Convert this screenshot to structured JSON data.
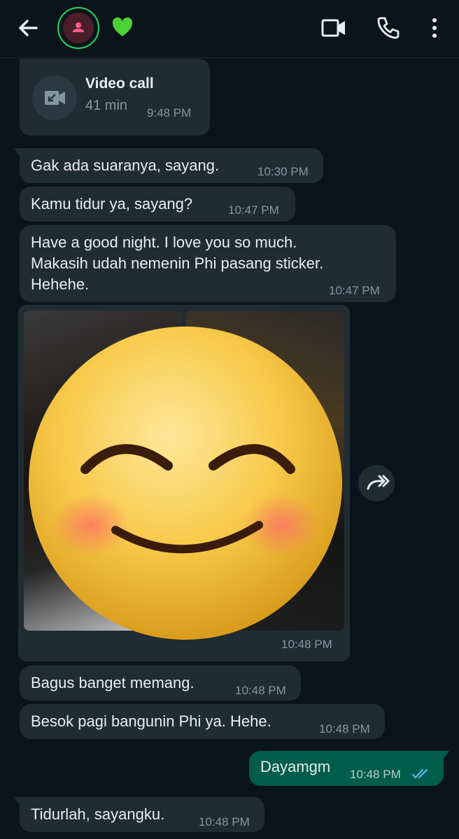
{
  "header": {
    "back_icon": "arrow-left-icon",
    "status_emoji": "green-heart-icon",
    "actions": [
      "video-call-icon",
      "voice-call-icon",
      "more-vert-icon"
    ]
  },
  "call_card": {
    "title": "Video call",
    "duration": "41 min",
    "time": "9:48 PM"
  },
  "messages": [
    {
      "text": "Gak ada suaranya, sayang.",
      "time": "10:30 PM"
    },
    {
      "text": "Kamu tidur ya, sayang?",
      "time": "10:47 PM"
    },
    {
      "lines": [
        "Have a good night. I love you so much.",
        "Makasih udah nemenin Phi pasang sticker.",
        "Hehehe."
      ],
      "time": "10:47 PM"
    },
    {
      "text": "Bagus banget memang.",
      "time": "10:48 PM"
    },
    {
      "text": "Besok pagi bangunin Phi ya. Hehe.",
      "time": "10:48 PM"
    },
    {
      "text": "Dayamgm",
      "time": "10:48 PM"
    },
    {
      "text": "Tidurlah, sayangku.",
      "time": "10:48 PM"
    }
  ],
  "media_message": {
    "time": "10:48 PM",
    "overlay_emoji": "smiling-face-with-blush-icon"
  },
  "colors": {
    "background": "#0b141a",
    "incoming_bubble": "#1f2c34",
    "outgoing_bubble": "#005c4b",
    "read_ticks": "#53bdeb",
    "accent_green": "#25d366"
  }
}
